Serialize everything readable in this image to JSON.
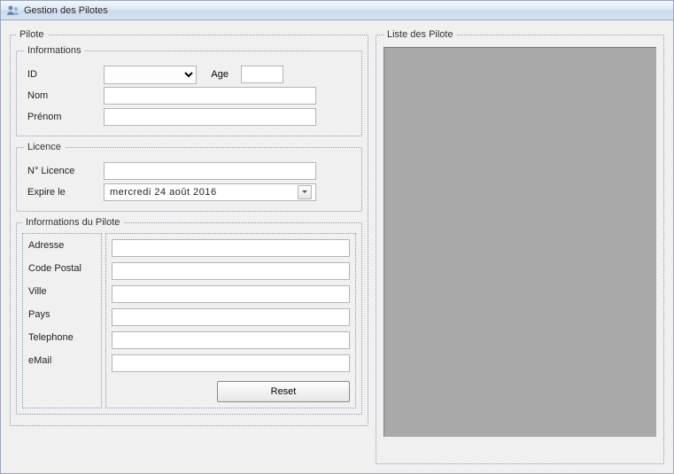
{
  "window": {
    "title": "Gestion des Pilotes"
  },
  "left": {
    "group_label": "Pilote",
    "informations": {
      "group_label": "Informations",
      "id_label": "ID",
      "id_value": "",
      "age_label": "Age",
      "age_value": "",
      "nom_label": "Nom",
      "nom_value": "",
      "prenom_label": "Prénom",
      "prenom_value": ""
    },
    "licence": {
      "group_label": "Licence",
      "num_label": "N° Licence",
      "num_value": "",
      "expire_label": "Expire le",
      "expire_value": "mercredi  24     août      2016"
    },
    "details": {
      "group_label": "Informations du Pilote",
      "adresse_label": "Adresse",
      "adresse_value": "",
      "cp_label": "Code Postal",
      "cp_value": "",
      "ville_label": "Ville",
      "ville_value": "",
      "pays_label": "Pays",
      "pays_value": "",
      "tel_label": "Telephone",
      "tel_value": "",
      "email_label": "eMail",
      "email_value": "",
      "reset_label": "Reset"
    }
  },
  "right": {
    "group_label": "Liste des Pilote"
  }
}
